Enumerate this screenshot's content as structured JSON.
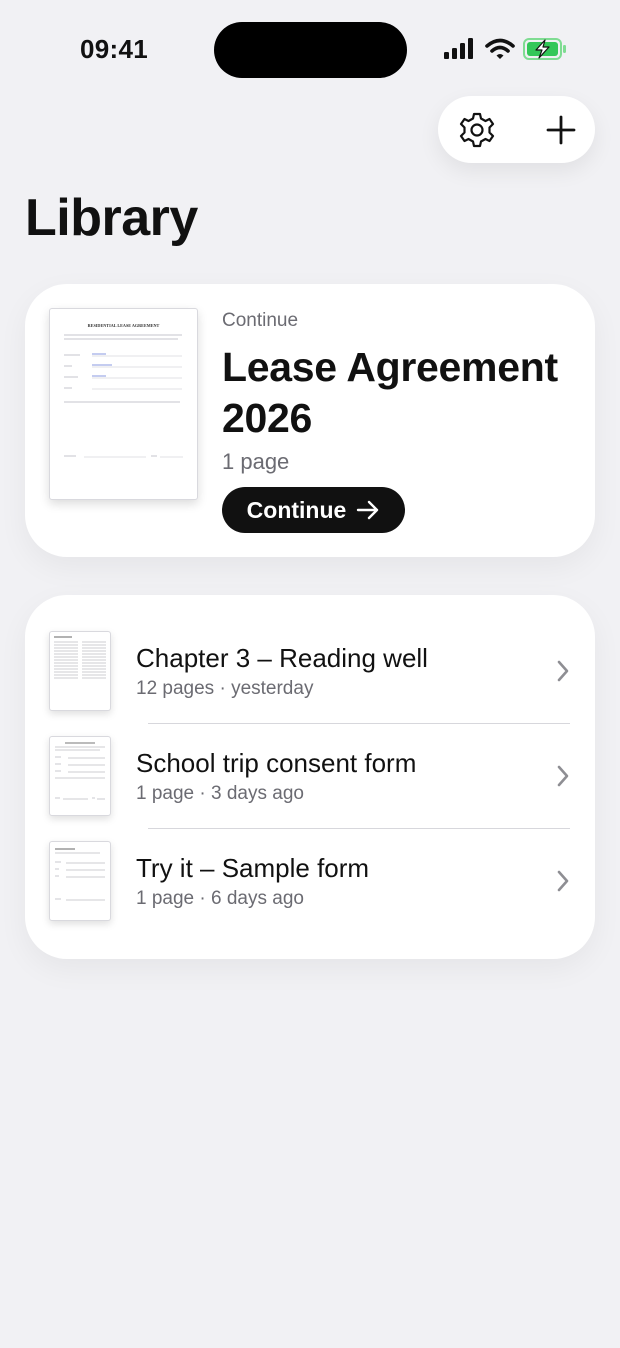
{
  "status_bar": {
    "time": "09:41",
    "icons": [
      "cellular-signal-icon",
      "wifi-icon",
      "battery-charging-icon"
    ]
  },
  "toolbar": {
    "settings_icon": "gear-icon",
    "add_icon": "plus-icon"
  },
  "page_title": "Library",
  "continue_card": {
    "eyebrow": "Continue",
    "title": "Lease Agreement 2026",
    "meta": "1 page",
    "button_label": "Continue",
    "button_icon": "arrow-right-icon",
    "thumbnail_heading": "RESIDENTIAL LEASE AGREEMENT"
  },
  "documents": [
    {
      "title": "Chapter 3 – Reading well",
      "meta": "12 pages · yesterday"
    },
    {
      "title": "School trip consent form",
      "meta": "1 page · 3 days ago"
    },
    {
      "title": "Try it – Sample form",
      "meta": "1 page · 6 days ago"
    }
  ],
  "colors": {
    "background": "#f1f1f4",
    "card": "#ffffff",
    "primary_button": "#111111",
    "secondary_text": "#6b6b72",
    "battery_green": "#34c759"
  }
}
